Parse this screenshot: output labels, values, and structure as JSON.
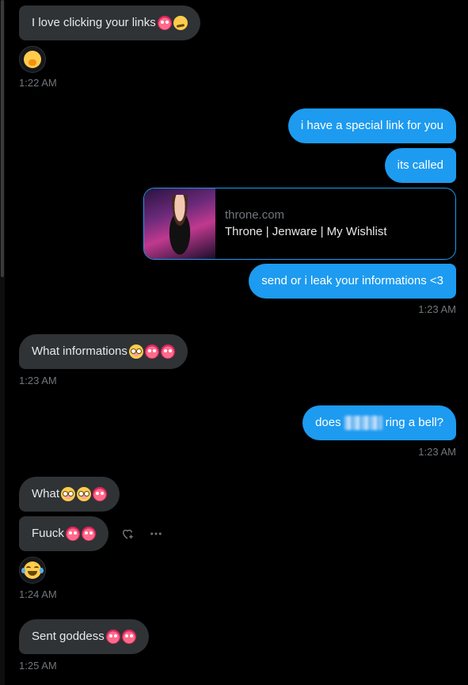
{
  "messages": {
    "m1": {
      "text": "I love clicking your links"
    },
    "t1": "1:22 AM",
    "m2": {
      "text": "i have a special link for you"
    },
    "m3": {
      "text": "its called"
    },
    "card": {
      "domain": "throne.com",
      "title": "Throne | Jenware | My Wishlist"
    },
    "m4": {
      "text": "send or i leak your informations <3"
    },
    "t2": "1:23 AM",
    "m5": {
      "text": "What informations"
    },
    "t3": "1:23 AM",
    "m6": {
      "before": "does",
      "after": "ring a bell?"
    },
    "t4": "1:23 AM",
    "m7": {
      "text": "What"
    },
    "m8": {
      "text": "Fuuck"
    },
    "t5": "1:24 AM",
    "m9": {
      "text": "Sent goddess"
    },
    "t6": "1:25 AM"
  },
  "reactions": {
    "r1": "shushing-face",
    "r2": "face-with-tears-of-joy"
  },
  "colors": {
    "outgoing": "#1d9bf0",
    "incoming": "#2f3336",
    "timestamp": "#71767b",
    "background": "#000000"
  }
}
